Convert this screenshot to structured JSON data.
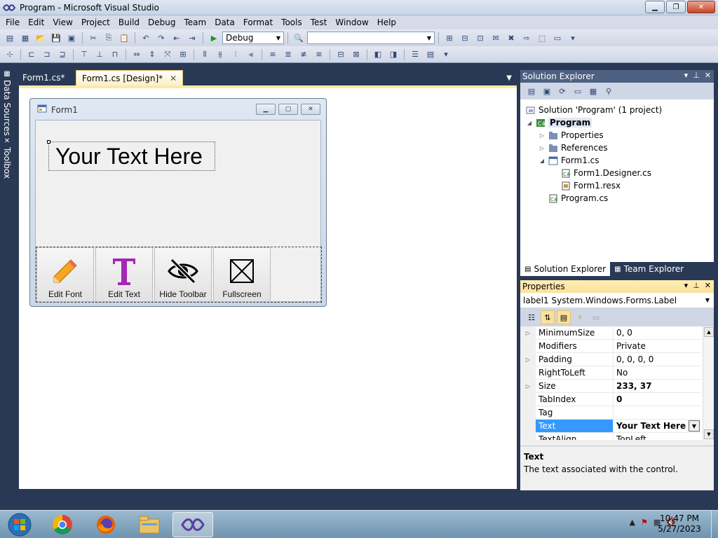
{
  "window": {
    "title": "Program - Microsoft Visual Studio"
  },
  "menu": [
    "File",
    "Edit",
    "View",
    "Project",
    "Build",
    "Debug",
    "Team",
    "Data",
    "Format",
    "Tools",
    "Test",
    "Window",
    "Help"
  ],
  "toolbar": {
    "config": "Debug",
    "platform": ""
  },
  "left_tabs": {
    "data_sources": "Data Sources",
    "toolbox": "Toolbox"
  },
  "doc_tabs": [
    {
      "label": "Form1.cs*"
    },
    {
      "label": "Form1.cs [Design]*"
    }
  ],
  "form": {
    "title": "Form1",
    "label_text": "Your Text Here",
    "buttons": [
      {
        "label": "Edit Font",
        "icon": "pencil-icon"
      },
      {
        "label": "Edit Text",
        "icon": "text-t-icon"
      },
      {
        "label": "Hide Toolbar",
        "icon": "eye-slash-icon"
      },
      {
        "label": "Fullscreen",
        "icon": "fullscreen-icon"
      }
    ]
  },
  "solution_explorer": {
    "title": "Solution Explorer",
    "tree": [
      {
        "label": "Solution 'Program' (1 project)"
      },
      {
        "label": "Program"
      },
      {
        "label": "Properties"
      },
      {
        "label": "References"
      },
      {
        "label": "Form1.cs"
      },
      {
        "label": "Form1.Designer.cs"
      },
      {
        "label": "Form1.resx"
      },
      {
        "label": "Program.cs"
      }
    ],
    "tabs": [
      "Solution Explorer",
      "Team Explorer"
    ]
  },
  "properties": {
    "title": "Properties",
    "object_name": "label1",
    "object_type": "System.Windows.Forms.Label",
    "rows": [
      {
        "name": "MinimumSize",
        "value": "0, 0"
      },
      {
        "name": "Modifiers",
        "value": "Private"
      },
      {
        "name": "Padding",
        "value": "0, 0, 0, 0"
      },
      {
        "name": "RightToLeft",
        "value": "No"
      },
      {
        "name": "Size",
        "value": "233, 37"
      },
      {
        "name": "TabIndex",
        "value": "0"
      },
      {
        "name": "Tag",
        "value": ""
      },
      {
        "name": "Text",
        "value": "Your Text Here"
      },
      {
        "name": "TextAlign",
        "value": "TopLeft"
      }
    ],
    "desc_title": "Text",
    "desc_body": "The text associated with the control."
  },
  "taskbar": {
    "time": "10:47 PM",
    "date": "5/27/2023"
  }
}
